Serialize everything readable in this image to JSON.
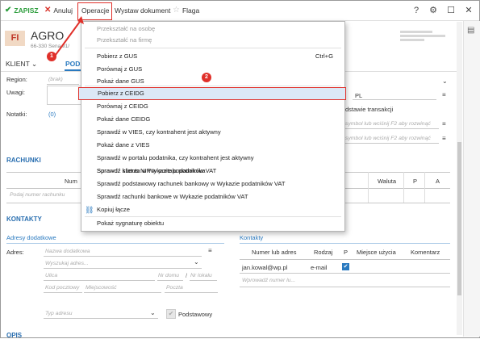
{
  "toolbar": {
    "save": "ZAPISZ",
    "cancel": "Anuluj",
    "operations": "Operacje",
    "issue_doc": "Wystaw dokument",
    "flag": "Flaga"
  },
  "header": {
    "badge": "FI",
    "title": "AGRO",
    "address": "66-330 Sena 91/"
  },
  "tabs": {
    "client": "KLIENT",
    "basic": "PODSTA"
  },
  "form": {
    "region_label": "Region:",
    "region_value": "(brak)",
    "notes_label": "Uwagi:",
    "notatki_label": "Notatki:",
    "notatki_value": "(0)",
    "country_code": "PL",
    "transaction_basis": "dstawie transakcji",
    "symbol_hint_1": "symbol lub wciśnij F2 aby rozwinąć",
    "symbol_hint_2": "symbol lub wciśnij F2 aby rozwinąć"
  },
  "accounts": {
    "title": "RACHUNKI",
    "col_number": "Num",
    "col_currency": "Waluta",
    "col_p": "P",
    "col_a": "A",
    "placeholder": "Podaj numer rachunku"
  },
  "contacts": {
    "title": "KONTAKTY",
    "extra_addresses": "Adresy dodatkowe",
    "address_label": "Adres:",
    "name_placeholder": "Nazwa dodatkowa",
    "search_placeholder": "Wyszukaj adres...",
    "street_placeholder": "Ulica",
    "house_placeholder": "Nr domu",
    "local_placeholder": "Nr lokalu",
    "zip_placeholder": "Kod pocztowy",
    "city_placeholder": "Miejscowość",
    "post_placeholder": "Poczta",
    "type_placeholder": "Typ adresu",
    "primary_label": "Podstawowy",
    "contacts_sub": "Kontakty",
    "col_number": "Numer lub adres",
    "col_type": "Rodzaj",
    "col_p": "P",
    "col_place": "Miejsce użycia",
    "col_comment": "Komentarz",
    "row_email": "jan.kowal@wp.pl",
    "row_type": "e-mail",
    "new_placeholder": "Wprowadź numer lu..."
  },
  "bottom_section": "OPIS",
  "menu": {
    "items": [
      "Przekształć na osobę",
      "Przekształć na firmę",
      "Pobierz z GUS",
      "Porównaj z GUS",
      "Pokaż dane GUS",
      "Pobierz z CEIDG",
      "Porównaj z CEIDG",
      "Pokaż dane CEIDG",
      "Sprawdź w VIES, czy kontrahent jest aktywny",
      "Pokaż dane z VIES",
      "Sprawdź w portalu podatnika, czy kontrahent jest aktywny",
      "Sprawdź status NIP w portalu podatnika",
      "Sprawdź klienta w Wykazie podatników VAT",
      "Sprawdź podstawowy rachunek bankowy w Wykazie podatników VAT",
      "Sprawdź rachunki bankowe w Wykazie podatników VAT",
      "Kopiuj łącze",
      "Pokaż sygnaturę obiektu"
    ],
    "shortcut_gus": "Ctrl+G"
  },
  "annotations": {
    "step1": "1",
    "step2": "2"
  },
  "colors": {
    "accent": "#2a7ac0",
    "highlight": "#e0302a",
    "save_green": "#2e9e3e"
  },
  "icons": {
    "save": "check-icon",
    "cancel": "close-icon",
    "flag": "star-icon",
    "help": "question-icon",
    "settings": "gear-icon",
    "maximize": "maximize-icon",
    "close_window": "close-window-icon",
    "copy_link": "link-icon"
  }
}
